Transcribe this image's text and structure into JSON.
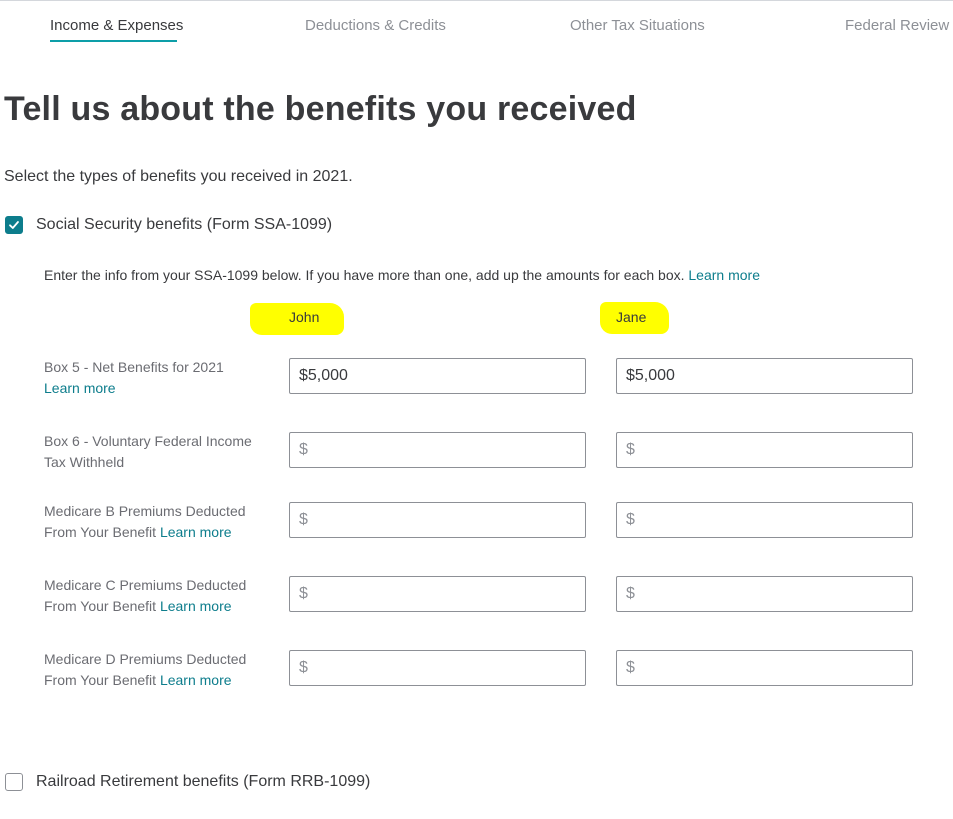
{
  "nav": {
    "tabs": [
      {
        "label": "Income & Expenses",
        "active": true
      },
      {
        "label": "Deductions & Credits",
        "active": false
      },
      {
        "label": "Other Tax Situations",
        "active": false
      },
      {
        "label": "Federal Review",
        "active": false
      }
    ]
  },
  "page": {
    "title": "Tell us about the benefits you received",
    "subtitle": "Select the types of benefits you received in 2021."
  },
  "social_security": {
    "checked": true,
    "label": "Social Security benefits (Form SSA-1099)",
    "info_text": "Enter the info from your SSA-1099 below. If you have more than one, add up the amounts for each box.",
    "info_link": "Learn more"
  },
  "columns": {
    "person1": "John",
    "person2": "Jane"
  },
  "rows": [
    {
      "label": "Box 5 - Net Benefits for 2021",
      "link": "Learn more",
      "john_value": "$5,000",
      "jane_value": "$5,000",
      "placeholder": "$"
    },
    {
      "label": "Box 6 - Voluntary Federal Income Tax Withheld",
      "john_value": "",
      "jane_value": "",
      "placeholder": "$"
    },
    {
      "label": "Medicare B Premiums Deducted From Your Benefit",
      "link": "Learn more",
      "john_value": "",
      "jane_value": "",
      "placeholder": "$"
    },
    {
      "label": "Medicare C Premiums Deducted From Your Benefit",
      "link": "Learn more",
      "john_value": "",
      "jane_value": "",
      "placeholder": "$"
    },
    {
      "label": "Medicare D Premiums Deducted From Your Benefit",
      "link": "Learn more",
      "john_value": "",
      "jane_value": "",
      "placeholder": "$"
    }
  ],
  "railroad": {
    "checked": false,
    "label": "Railroad Retirement benefits (Form RRB-1099)"
  },
  "colors": {
    "accent": "#0d7d8c",
    "highlight": "#ffff00"
  },
  "icons": {
    "checkmark": "check-icon"
  }
}
